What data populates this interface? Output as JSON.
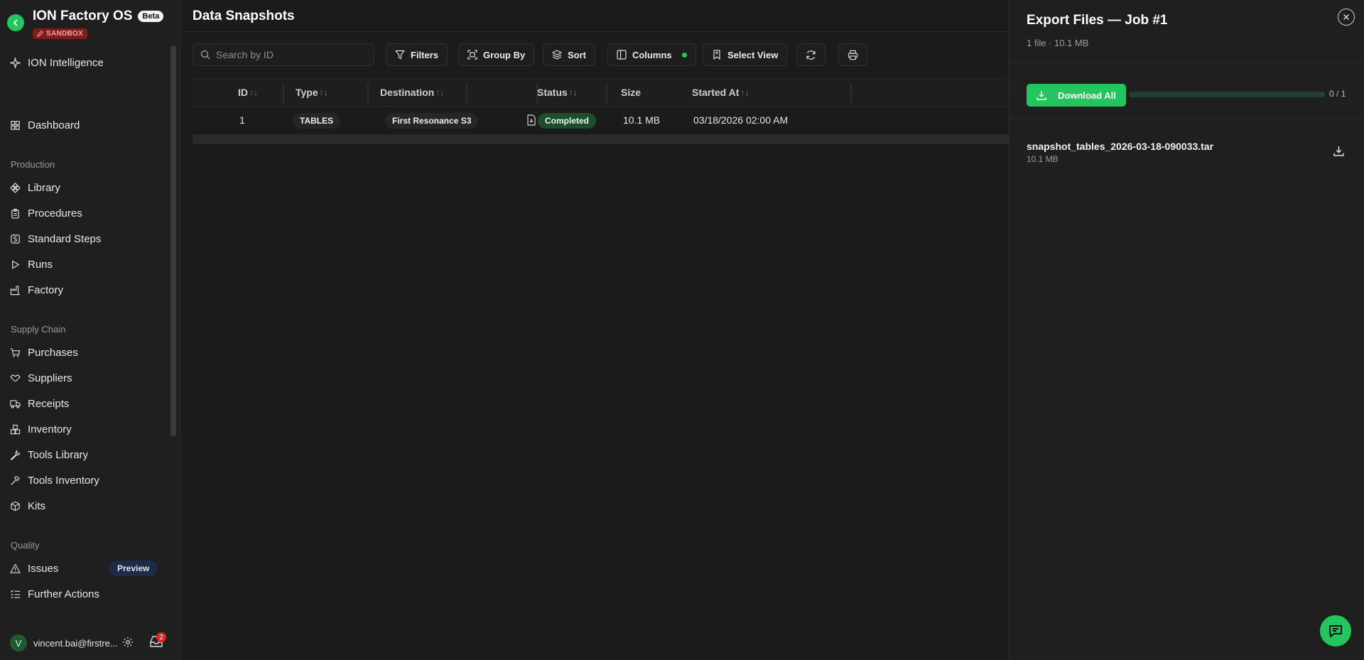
{
  "app": {
    "title": "ION Factory OS",
    "beta": "Beta",
    "sandbox": "SANDBOX"
  },
  "sidebar": {
    "intelligence": "ION Intelligence",
    "dashboard": "Dashboard",
    "sections": {
      "production": "Production",
      "supply_chain": "Supply Chain",
      "quality": "Quality"
    },
    "items": {
      "library": "Library",
      "procedures": "Procedures",
      "standard_steps": "Standard Steps",
      "runs": "Runs",
      "factory": "Factory",
      "purchases": "Purchases",
      "suppliers": "Suppliers",
      "receipts": "Receipts",
      "inventory": "Inventory",
      "tools_library": "Tools Library",
      "tools_inventory": "Tools Inventory",
      "kits": "Kits",
      "issues": "Issues",
      "further_actions": "Further Actions"
    },
    "issues_badge": "Preview",
    "user": {
      "initial": "V",
      "email": "vincent.bai@firstre...",
      "inbox_count": "2"
    }
  },
  "main": {
    "title": "Data Snapshots",
    "search": {
      "placeholder": "Search by ID"
    },
    "toolbar": {
      "filters": "Filters",
      "group_by": "Group By",
      "sort": "Sort",
      "columns": "Columns",
      "select_view": "Select View"
    },
    "table": {
      "headers": {
        "id": "ID",
        "type": "Type",
        "destination": "Destination",
        "status": "Status",
        "size": "Size",
        "started_at": "Started At"
      },
      "rows": [
        {
          "id": "1",
          "type": "TABLES",
          "destination": "First Resonance S3",
          "status": "Completed",
          "size": "10.1 MB",
          "started_at": "03/18/2026 02:00 AM"
        }
      ]
    }
  },
  "drawer": {
    "title": "Export Files — Job #1",
    "subtitle": "1 file · 10.1 MB",
    "download_all": "Download All",
    "progress": {
      "done": 0,
      "total": 1,
      "label": "0 / 1"
    },
    "files": [
      {
        "name": "snapshot_tables_2026-03-18-090033.tar",
        "size": "10.1 MB"
      }
    ]
  },
  "colors": {
    "accent": "#22c55e",
    "sandbox": "#7f1d1d",
    "preview_badge": "#1e2a4a",
    "status_completed": "#1d4d2c"
  }
}
